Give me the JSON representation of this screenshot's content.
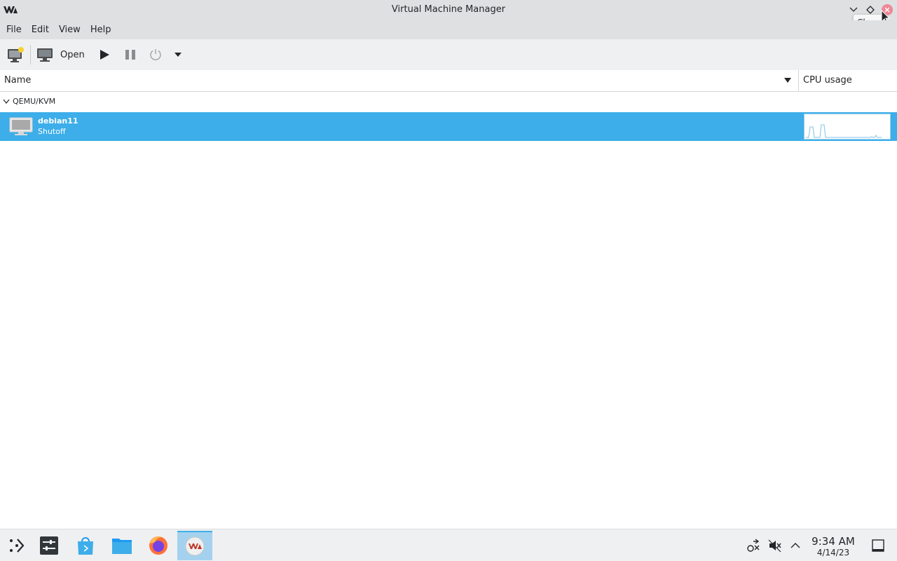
{
  "window": {
    "title": "Virtual Machine Manager",
    "tooltip": "Close"
  },
  "menu": [
    "File",
    "Edit",
    "View",
    "Help"
  ],
  "toolbar": {
    "new_vm_icon": "new-vm-icon",
    "open_label": "Open",
    "run_icon": "play-icon",
    "pause_icon": "pause-icon",
    "shutdown_icon": "power-icon",
    "menu_icon": "dropdown-arrow-icon"
  },
  "columns": {
    "name": "Name",
    "cpu": "CPU usage"
  },
  "group": {
    "label": "QEMU/KVM"
  },
  "vms": [
    {
      "name": "debian11",
      "status": "Shutoff"
    }
  ],
  "taskbar": {
    "apps": [
      "app-launcher-icon",
      "system-settings-icon",
      "discover-store-icon",
      "file-manager-icon",
      "firefox-icon",
      "virt-manager-icon"
    ],
    "clock_time": "9:34 AM",
    "clock_date": "4/14/23"
  },
  "colors": {
    "selection": "#3daee9",
    "titlebar": "#dee0e2",
    "toolbar": "#eff0f1",
    "close": "#ed8796"
  }
}
